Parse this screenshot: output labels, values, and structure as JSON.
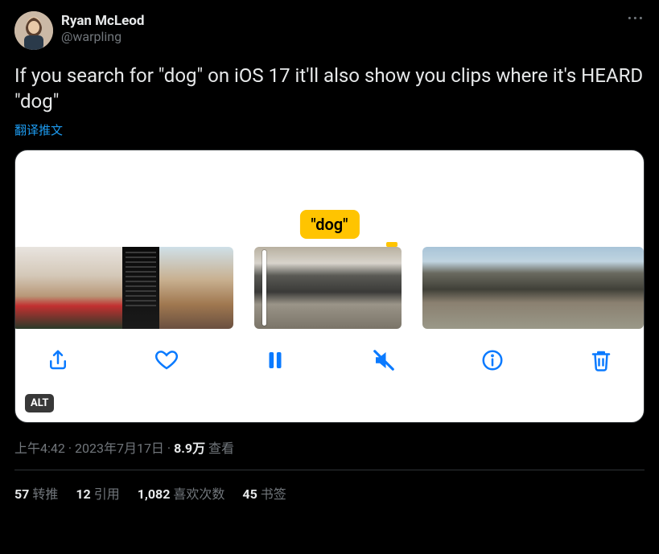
{
  "author": {
    "display_name": "Ryan McLeod",
    "handle": "@warpling"
  },
  "tweet_text": "If you search for \"dog\" on iOS 17 it'll also show you clips where it's HEARD \"dog\"",
  "translate_label": "翻译推文",
  "media": {
    "search_term_label": "\"dog\"",
    "alt_badge": "ALT",
    "toolbar_icons": {
      "share": "share-icon",
      "like": "heart-icon",
      "pause": "pause-icon",
      "mute": "mute-icon",
      "info": "info-icon",
      "trash": "trash-icon"
    }
  },
  "meta": {
    "time": "上午4:42",
    "separator": " · ",
    "date": "2023年7月17日",
    "views_count": "8.9万",
    "views_label": " 查看"
  },
  "stats": {
    "retweets": {
      "count": "57",
      "label": "转推"
    },
    "quotes": {
      "count": "12",
      "label": "引用"
    },
    "likes": {
      "count": "1,082",
      "label": "喜欢次数"
    },
    "bookmarks": {
      "count": "45",
      "label": "书签"
    }
  },
  "more_label": "•••"
}
